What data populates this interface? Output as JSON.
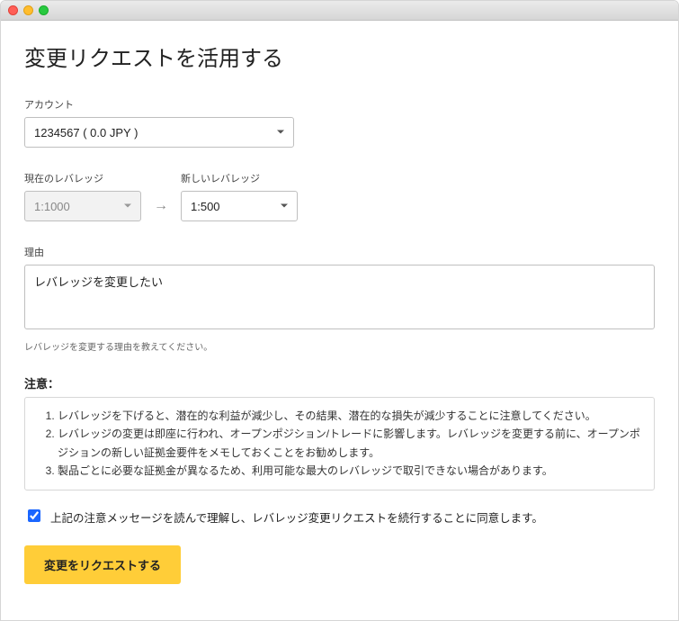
{
  "page": {
    "title": "変更リクエストを活用する"
  },
  "account": {
    "label": "アカウント",
    "selected": "1234567 ( 0.0 JPY )"
  },
  "leverage": {
    "current_label": "現在のレバレッジ",
    "current_value": "1:1000",
    "new_label": "新しいレバレッジ",
    "new_value": "1:500"
  },
  "reason": {
    "label": "理由",
    "value": "レバレッジを変更したい",
    "helper": "レバレッジを変更する理由を教えてください。"
  },
  "notice": {
    "title": "注意：",
    "items": [
      "レバレッジを下げると、潜在的な利益が減少し、その結果、潜在的な損失が減少することに注意してください。",
      "レバレッジの変更は即座に行われ、オープンポジション/トレードに影響します。レバレッジを変更する前に、オープンポジションの新しい証拠金要件をメモしておくことをお勧めします。",
      "製品ごとに必要な証拠金が異なるため、利用可能な最大のレバレッジで取引できない場合があります。"
    ]
  },
  "consent": {
    "text": "上記の注意メッセージを読んで理解し、レバレッジ変更リクエストを続行することに同意します。",
    "checked": true
  },
  "submit": {
    "label": "変更をリクエストする"
  }
}
